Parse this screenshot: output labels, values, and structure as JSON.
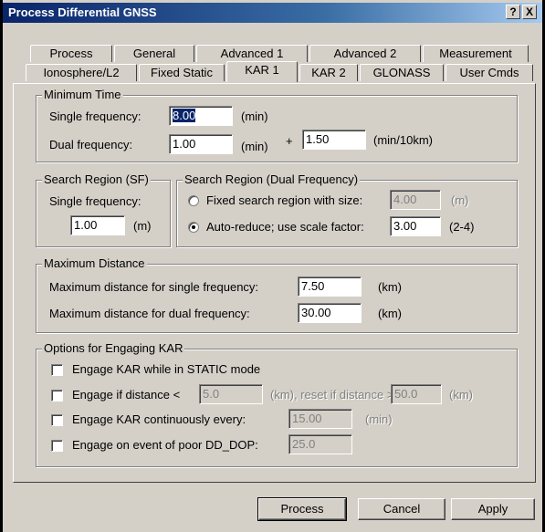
{
  "window": {
    "title": "Process Differential GNSS",
    "help_btn": "?",
    "close_btn": "X"
  },
  "tabs": {
    "row1": [
      "Process",
      "General",
      "Advanced 1",
      "Advanced 2",
      "Measurement"
    ],
    "row2": [
      "Ionosphere/L2",
      "Fixed Static",
      "KAR 1",
      "KAR 2",
      "GLONASS",
      "User Cmds"
    ],
    "active": "KAR 1"
  },
  "minimum_time": {
    "label": "Minimum Time",
    "single_label": "Single frequency:",
    "single_value": "8.00",
    "single_unit": "(min)",
    "dual_label": "Dual frequency:",
    "dual_value": "1.00",
    "dual_unit": "(min)",
    "plus": "+",
    "extra_value": "1.50",
    "extra_unit": "(min/10km)"
  },
  "search_region_sf": {
    "label": "Search Region (SF)",
    "single_label": "Single frequency:",
    "value": "1.00",
    "unit": "(m)"
  },
  "search_region_df": {
    "label": "Search Region (Dual Frequency)",
    "fixed_label": "Fixed search region with size:",
    "fixed_value": "4.00",
    "fixed_unit": "(m)",
    "auto_label": "Auto-reduce; use scale factor:",
    "auto_value": "3.00",
    "auto_unit": "(2-4)"
  },
  "max_distance": {
    "label": "Maximum Distance",
    "single_label": "Maximum distance for single frequency:",
    "single_value": "7.50",
    "single_unit": "(km)",
    "dual_label": "Maximum distance for dual frequency:",
    "dual_value": "30.00",
    "dual_unit": "(km)"
  },
  "options": {
    "label": "Options for Engaging KAR",
    "static_label": "Engage KAR while in STATIC mode",
    "distance_label": "Engage if distance <",
    "distance_value": "5.0",
    "reset_label": "(km), reset if distance >",
    "reset_value": "50.0",
    "reset_unit": "(km)",
    "continuous_label": "Engage KAR continuously every:",
    "continuous_value": "15.00",
    "continuous_unit": "(min)",
    "dop_label": "Engage on event of poor DD_DOP:",
    "dop_value": "25.0"
  },
  "buttons": {
    "process": "Process",
    "cancel": "Cancel",
    "apply": "Apply"
  }
}
